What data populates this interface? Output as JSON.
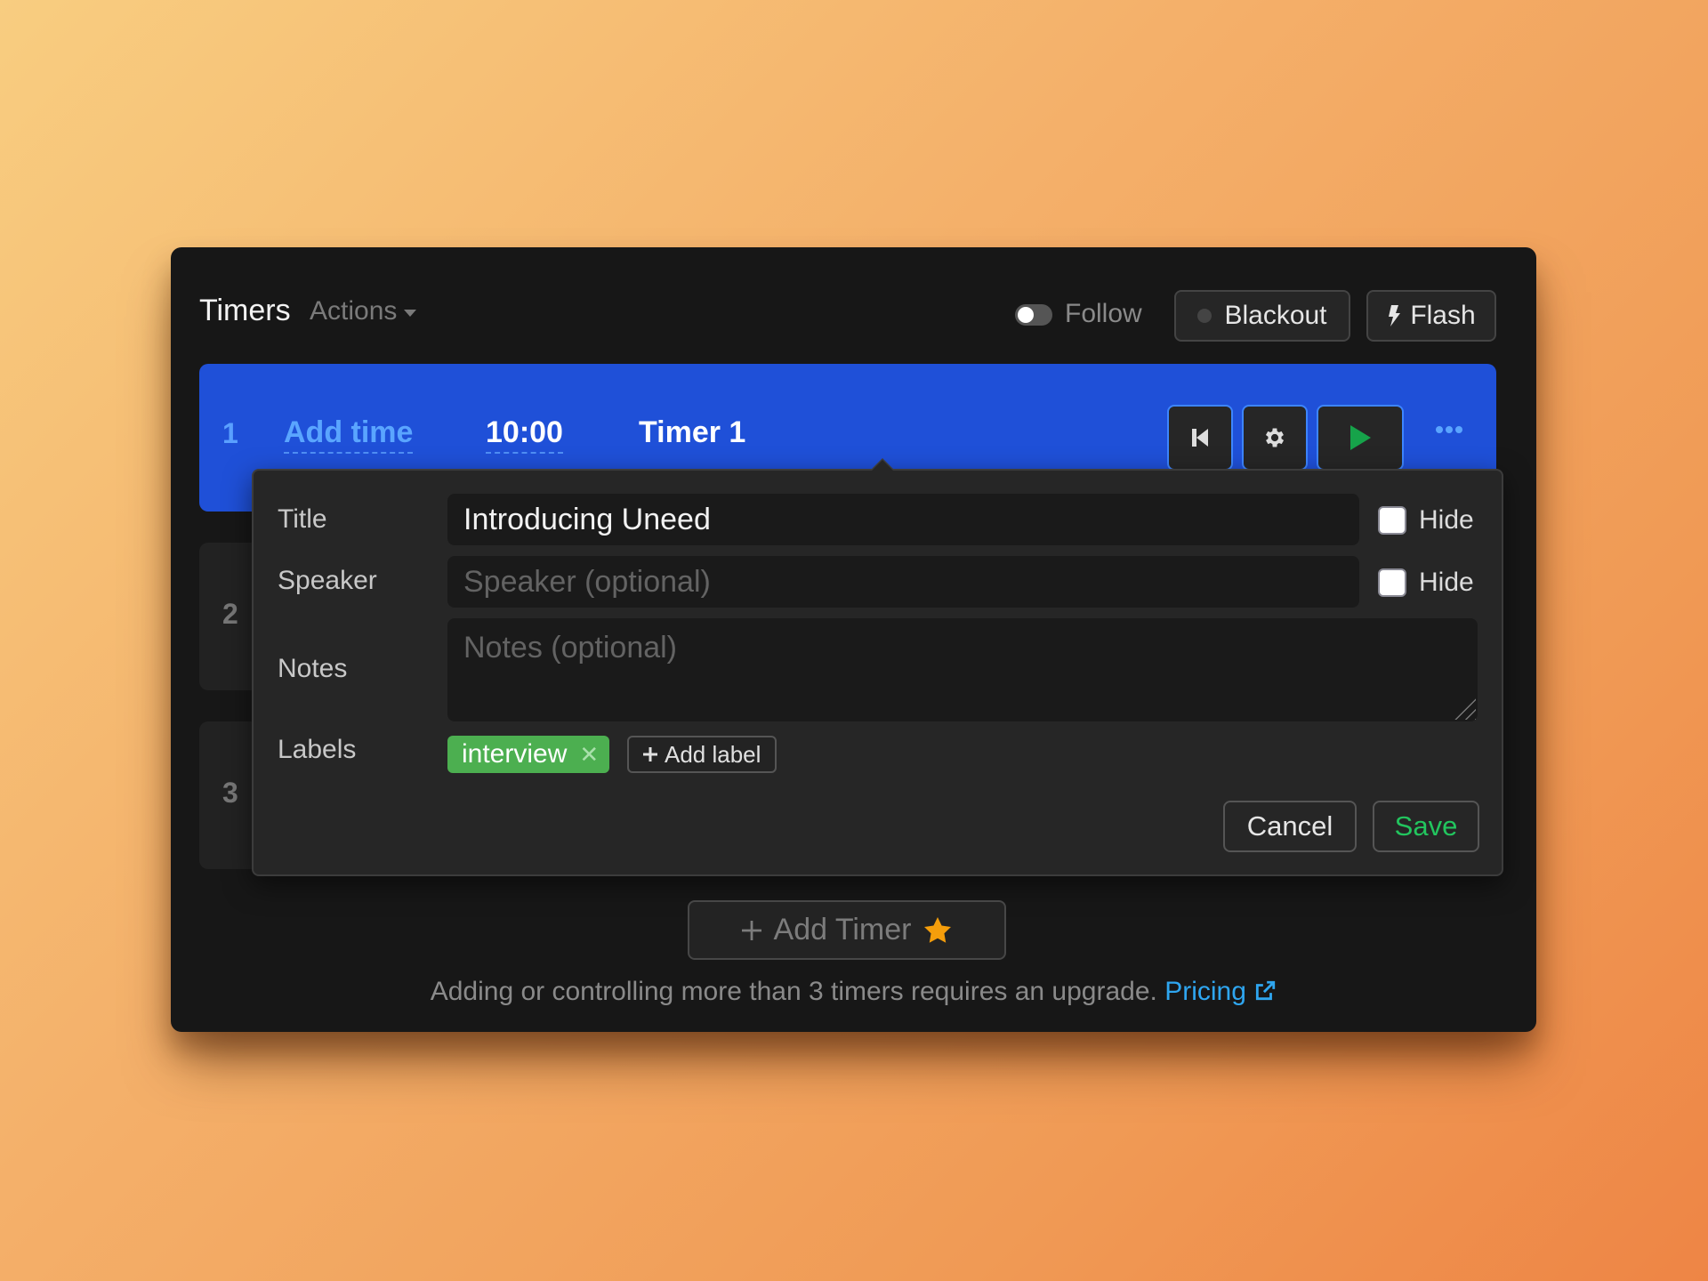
{
  "header": {
    "title": "Timers",
    "actions_label": "Actions",
    "follow_label": "Follow",
    "follow_on": false,
    "blackout_label": "Blackout",
    "flash_label": "Flash"
  },
  "timers": [
    {
      "index": "1",
      "add_time_label": "Add time",
      "duration": "10:00",
      "name": "Timer 1",
      "active": true
    },
    {
      "index": "2"
    },
    {
      "index": "3"
    }
  ],
  "editor": {
    "title_label": "Title",
    "title_value": "Introducing Uneed",
    "speaker_label": "Speaker",
    "speaker_placeholder": "Speaker (optional)",
    "notes_label": "Notes",
    "notes_placeholder": "Notes (optional)",
    "hide_label": "Hide",
    "hide_title": false,
    "hide_speaker": false,
    "labels_label": "Labels",
    "labels": [
      {
        "name": "interview",
        "color": "#4caf50"
      }
    ],
    "add_label": "Add label",
    "cancel_label": "Cancel",
    "save_label": "Save"
  },
  "add_timer_label": "Add Timer",
  "footer": {
    "text": "Adding or controlling more than 3 timers requires an upgrade.",
    "link_label": "Pricing"
  },
  "colors": {
    "active_row": "#1f50d8",
    "accent_blue": "#5aa5ff",
    "play_green": "#16a34a",
    "save_green": "#22c55e",
    "star": "#f59e0b",
    "link": "#2fa6f0"
  }
}
